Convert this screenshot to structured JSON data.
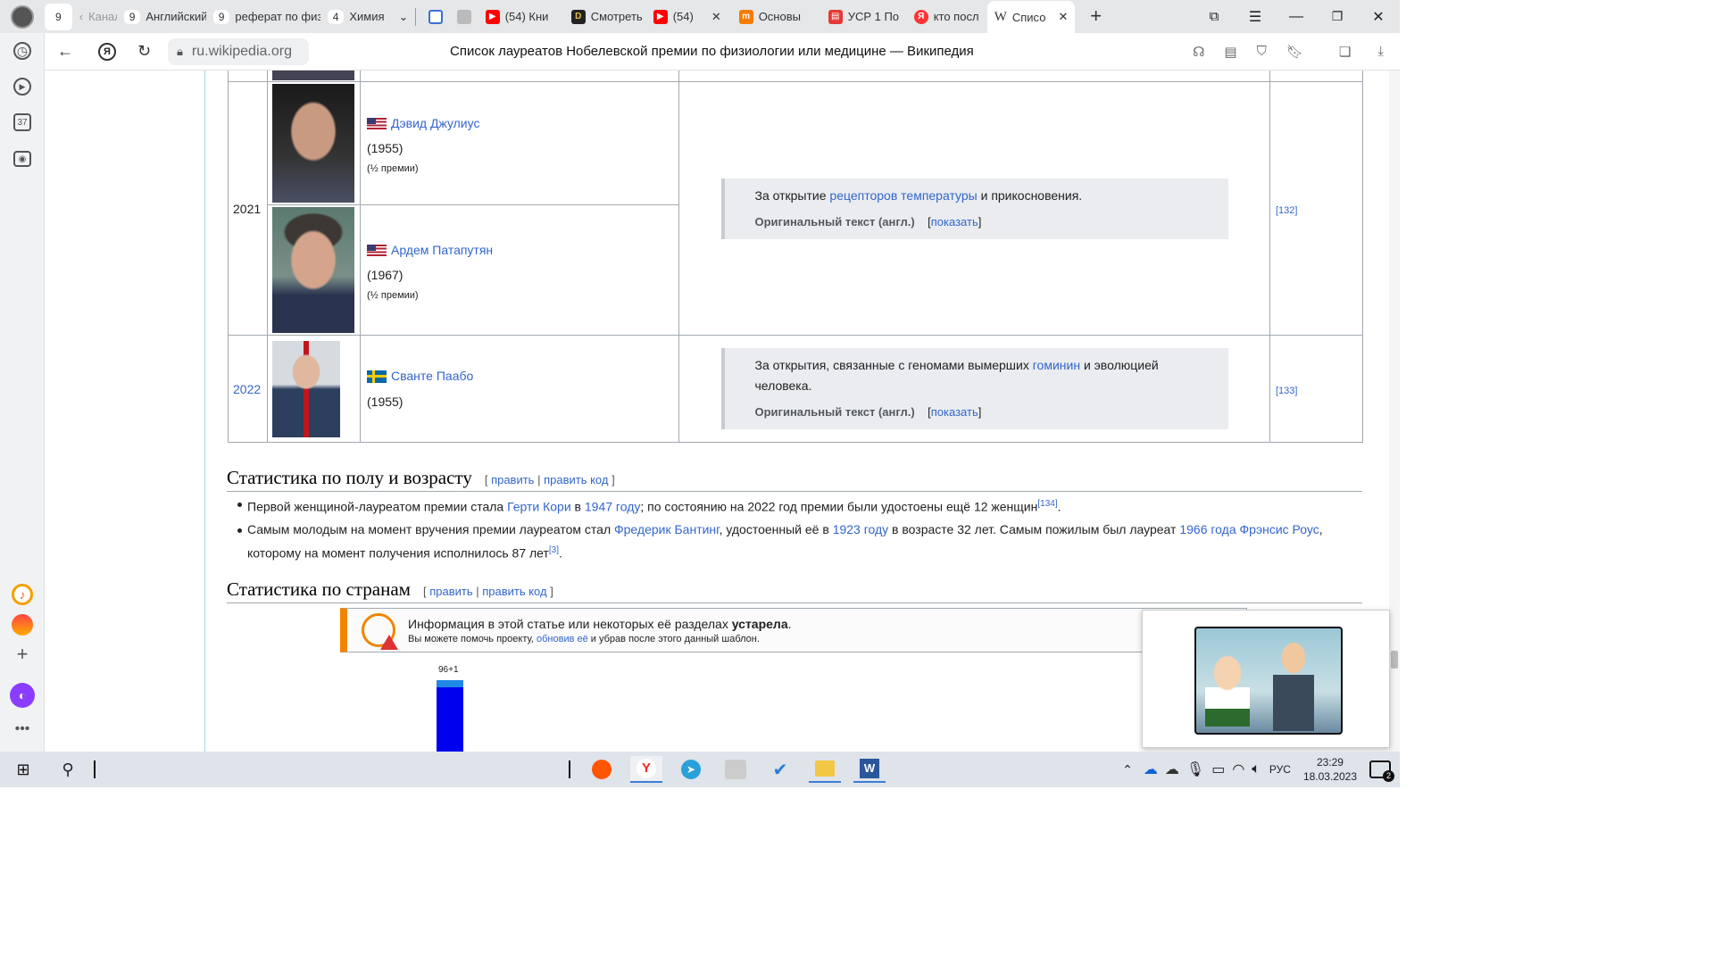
{
  "tabs": [
    {
      "count": "9",
      "label": ""
    },
    {
      "count": "",
      "label": "Канал"
    },
    {
      "count": "9",
      "label": "Английский"
    },
    {
      "count": "9",
      "label": "реферат по физ"
    },
    {
      "count": "4",
      "label": "Химия"
    },
    {
      "count": "",
      "label": ""
    },
    {
      "count": "",
      "label": ""
    },
    {
      "count": "",
      "label": "(54) Кни"
    },
    {
      "count": "",
      "label": "Смотреть"
    },
    {
      "count": "",
      "label": "(54)"
    },
    {
      "count": "",
      "label": "Основы"
    },
    {
      "count": "",
      "label": "УСР 1 По"
    },
    {
      "count": "",
      "label": "кто посл"
    },
    {
      "count": "",
      "label": "Списо"
    }
  ],
  "address": {
    "domain": "ru.wikipedia.org",
    "page_title": "Список лауреатов Нобелевской премии по физиологии или медицине — Википедия"
  },
  "table": {
    "rows": [
      {
        "year": "2021",
        "laureates": [
          {
            "name": "Дэвид Джулиус",
            "years": "(1955)",
            "share": "(½ премии)"
          },
          {
            "name": "Ардем Патапутян",
            "years": "(1967)",
            "share": "(½ премии)"
          }
        ],
        "rationale_parts": [
          "За открытие ",
          "рецепторов температуры",
          " и прикосновения."
        ],
        "orig_label": "Оригинальный текст (англ.)",
        "show_label": "показать",
        "ref": "[132]"
      },
      {
        "year": "2022",
        "laureates": [
          {
            "name": "Сванте Паабо",
            "years": "(1955)"
          }
        ],
        "rationale_parts": [
          "За открытия, связанные с геномами вымерших ",
          "гоминин",
          " и эволюцией человека."
        ],
        "orig_label": "Оригинальный текст (англ.)",
        "show_label": "показать",
        "ref": "[133]"
      }
    ]
  },
  "section1": {
    "title": "Статистика по полу и возрасту",
    "edit": "править",
    "edit_code": "править код",
    "b1": [
      "Первой женщиной-лауреатом премии стала ",
      "Герти Кори",
      " в ",
      "1947 году",
      "; по состоянию на 2022 год премии были удостоены ещё 12 женщин",
      "[134]",
      "."
    ],
    "b2": [
      "Самым молодым на момент вручения премии лауреатом стал ",
      "Фредерик Бантинг",
      ", удостоенный её в ",
      "1923 году",
      " в возрасте 32 лет. Самым пожилым был лауреат ",
      "1966 года",
      " ",
      "Фрэнсис Роус",
      ", которому на момент получения исполнилось 87 лет",
      "[3]",
      "."
    ]
  },
  "section2": {
    "title": "Статистика по странам",
    "edit": "править",
    "edit_code": "править код"
  },
  "notice": {
    "line1_a": "Информация в этой статье или некоторых её разделах ",
    "line1_b": "устарела",
    ".": ".",
    "line2_a": "Вы можете помочь проекту, ",
    "line2_link": "обновив её",
    "line2_b": " и убрав после этого данный шаблон."
  },
  "chart_data": {
    "type": "bar",
    "bar_label": "96+1",
    "values": [
      96,
      1
    ]
  },
  "taskbar": {
    "lang": "РУС",
    "time": "23:29",
    "date": "18.03.2023",
    "notifications": "2"
  },
  "leftbar": {
    "badge": "37"
  },
  "colors": {
    "link": "#3366cc",
    "bar_main": "#0000ee",
    "bar_top": "#1e88e5",
    "notice_accent": "#f28500"
  }
}
